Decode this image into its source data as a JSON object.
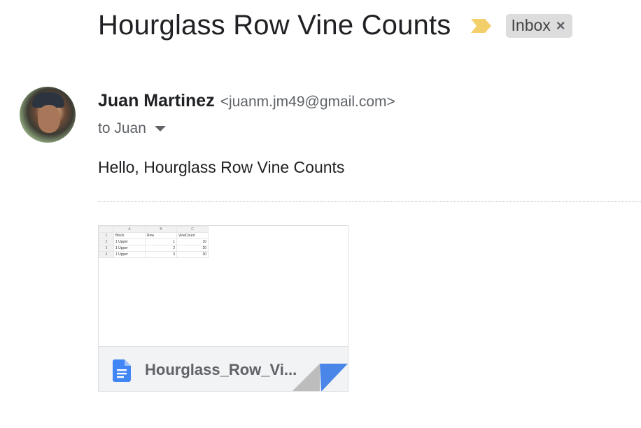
{
  "email": {
    "subject": "Hourglass Row Vine Counts",
    "label": "Inbox",
    "label_remove": "×",
    "sender_name": "Juan Martinez",
    "sender_email": "<juanm.jm49@gmail.com>",
    "recipient": "to Juan",
    "body": "Hello, Hourglass Row Vine Counts",
    "importance_icon": "importance-marker-icon",
    "importance_color": "#f2cf6b"
  },
  "attachment": {
    "file_name": "Hourglass_Row_Vi...",
    "icon": "google-docs-icon",
    "icon_color": "#4285f4",
    "preview": {
      "columns": [
        "A",
        "B",
        "C"
      ],
      "rows": [
        {
          "n": "1",
          "a": "Block",
          "b": "Row",
          "c": "VineCount"
        },
        {
          "n": "2",
          "a": "1 Upper",
          "b": "1",
          "c": "10"
        },
        {
          "n": "3",
          "a": "1 Upper",
          "b": "2",
          "c": "20"
        },
        {
          "n": "4",
          "a": "1 Upper",
          "b": "3",
          "c": "30"
        }
      ]
    }
  }
}
